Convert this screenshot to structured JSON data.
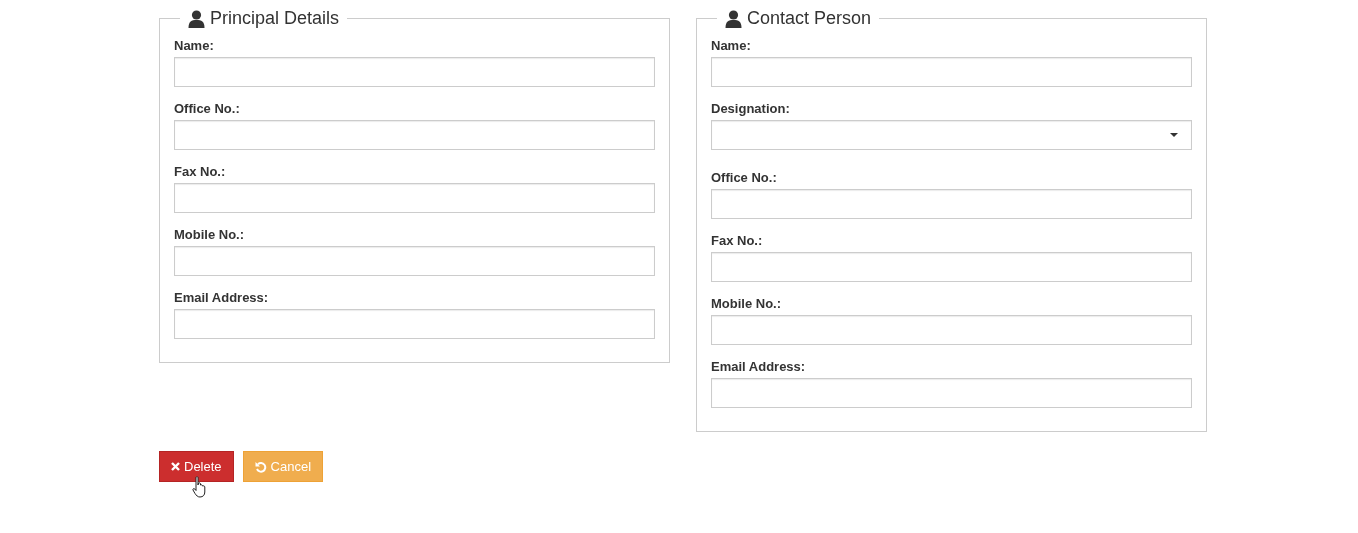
{
  "panels": [
    {
      "title": "Principal Details",
      "fields": [
        {
          "kind": "text",
          "label": "Name:"
        },
        {
          "kind": "text",
          "label": "Office No.:"
        },
        {
          "kind": "text",
          "label": "Fax No.:"
        },
        {
          "kind": "text",
          "label": "Mobile No.:"
        },
        {
          "kind": "text",
          "label": "Email Address:"
        }
      ]
    },
    {
      "title": "Contact Person",
      "fields": [
        {
          "kind": "text",
          "label": "Name:"
        },
        {
          "kind": "select",
          "label": "Designation:"
        },
        {
          "kind": "text",
          "label": "Office No.:"
        },
        {
          "kind": "text",
          "label": "Fax No.:"
        },
        {
          "kind": "text",
          "label": "Mobile No.:"
        },
        {
          "kind": "text",
          "label": "Email Address:"
        }
      ]
    }
  ],
  "buttons": [
    {
      "kind": "danger",
      "label": "Delete"
    },
    {
      "kind": "warning",
      "label": "Cancel"
    }
  ]
}
